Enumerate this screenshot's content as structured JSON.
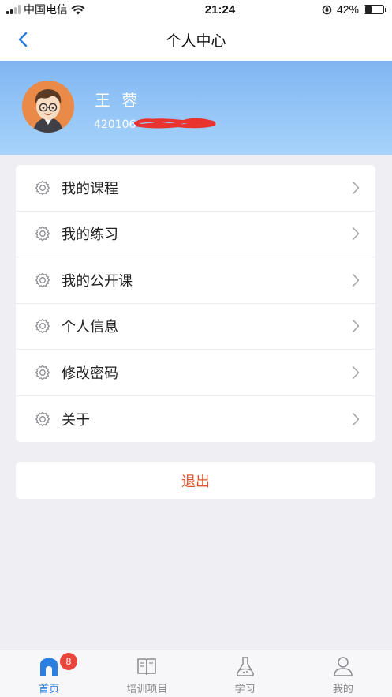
{
  "status_bar": {
    "carrier": "中国电信",
    "time": "21:24",
    "battery_percent": "42%",
    "battery_level": 0.42
  },
  "navbar": {
    "title": "个人中心"
  },
  "profile": {
    "name": "王 蓉",
    "id_visible": "420106"
  },
  "menu": {
    "items": [
      {
        "label": "我的课程",
        "icon": "gear-icon"
      },
      {
        "label": "我的练习",
        "icon": "gear-icon"
      },
      {
        "label": "我的公开课",
        "icon": "gear-icon"
      },
      {
        "label": "个人信息",
        "icon": "gear-icon"
      },
      {
        "label": "修改密码",
        "icon": "gear-icon"
      },
      {
        "label": "关于",
        "icon": "gear-icon"
      }
    ]
  },
  "logout": {
    "label": "退出",
    "color": "#d9542c"
  },
  "tabbar": {
    "tabs": [
      {
        "label": "首页",
        "icon": "home-icon",
        "active": true,
        "badge": "8"
      },
      {
        "label": "培训项目",
        "icon": "book-icon",
        "active": false
      },
      {
        "label": "学习",
        "icon": "flask-icon",
        "active": false
      },
      {
        "label": "我的",
        "icon": "user-icon",
        "active": false
      }
    ]
  },
  "colors": {
    "accent": "#2b7fe0",
    "header_gradient_top": "#7fb6f2",
    "header_gradient_bottom": "#a7d3fb",
    "badge": "#e8453c"
  }
}
